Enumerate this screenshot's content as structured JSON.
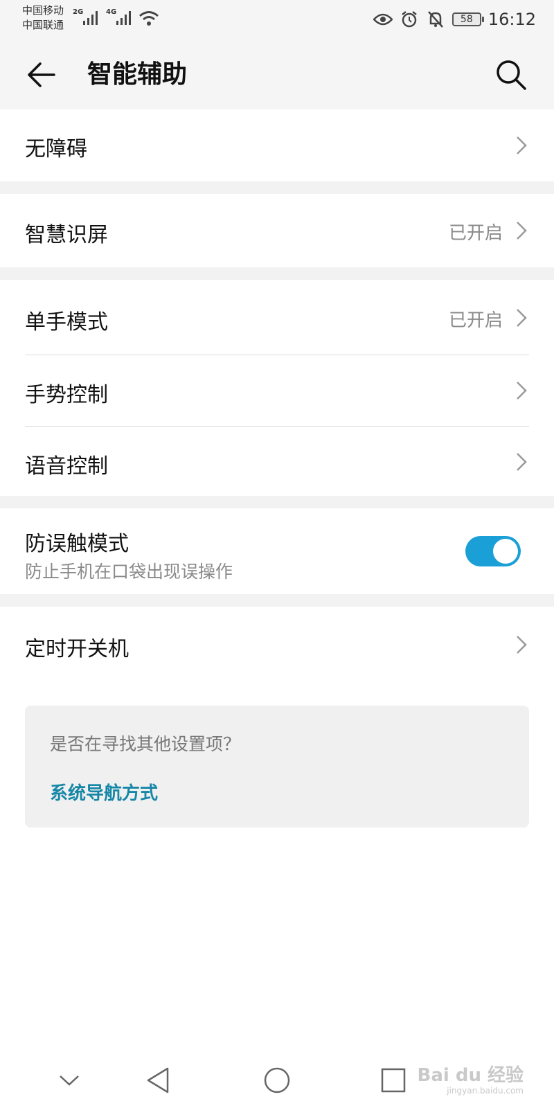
{
  "status_bar": {
    "carrier_1": "中国移动",
    "carrier_2": "中国联通",
    "net_1": "2G",
    "net_2": "4G",
    "battery": "58",
    "time": "16:12",
    "icons": [
      "signal-icon",
      "wifi-icon",
      "eye-icon",
      "alarm-icon",
      "mute-bell-icon",
      "battery-icon"
    ]
  },
  "app_bar": {
    "title": "智能辅助",
    "back_icon": "back-arrow-icon",
    "search_icon": "search-icon"
  },
  "settings": {
    "accessibility": {
      "label": "无障碍"
    },
    "smart_screen": {
      "label": "智慧识屏",
      "value": "已开启"
    },
    "one_hand": {
      "label": "单手模式",
      "value": "已开启"
    },
    "gesture": {
      "label": "手势控制"
    },
    "voice": {
      "label": "语音控制"
    },
    "pocket_mode": {
      "label": "防误触模式",
      "subtitle": "防止手机在口袋出现误操作",
      "enabled": true
    },
    "scheduled_power": {
      "label": "定时开关机"
    }
  },
  "hint_card": {
    "question": "是否在寻找其他设置项？",
    "link": "系统导航方式"
  },
  "nav_bar": {
    "icons": [
      "collapse-chevron-icon",
      "back-triangle-icon",
      "home-circle-icon",
      "recents-square-icon"
    ],
    "watermark": "Bai du 经验",
    "watermark_url": "jingyan.baidu.com"
  },
  "colors": {
    "accent": "#1a9fd6",
    "link": "#1687a7",
    "background": "#ffffff",
    "band": "#f2f2f2"
  }
}
